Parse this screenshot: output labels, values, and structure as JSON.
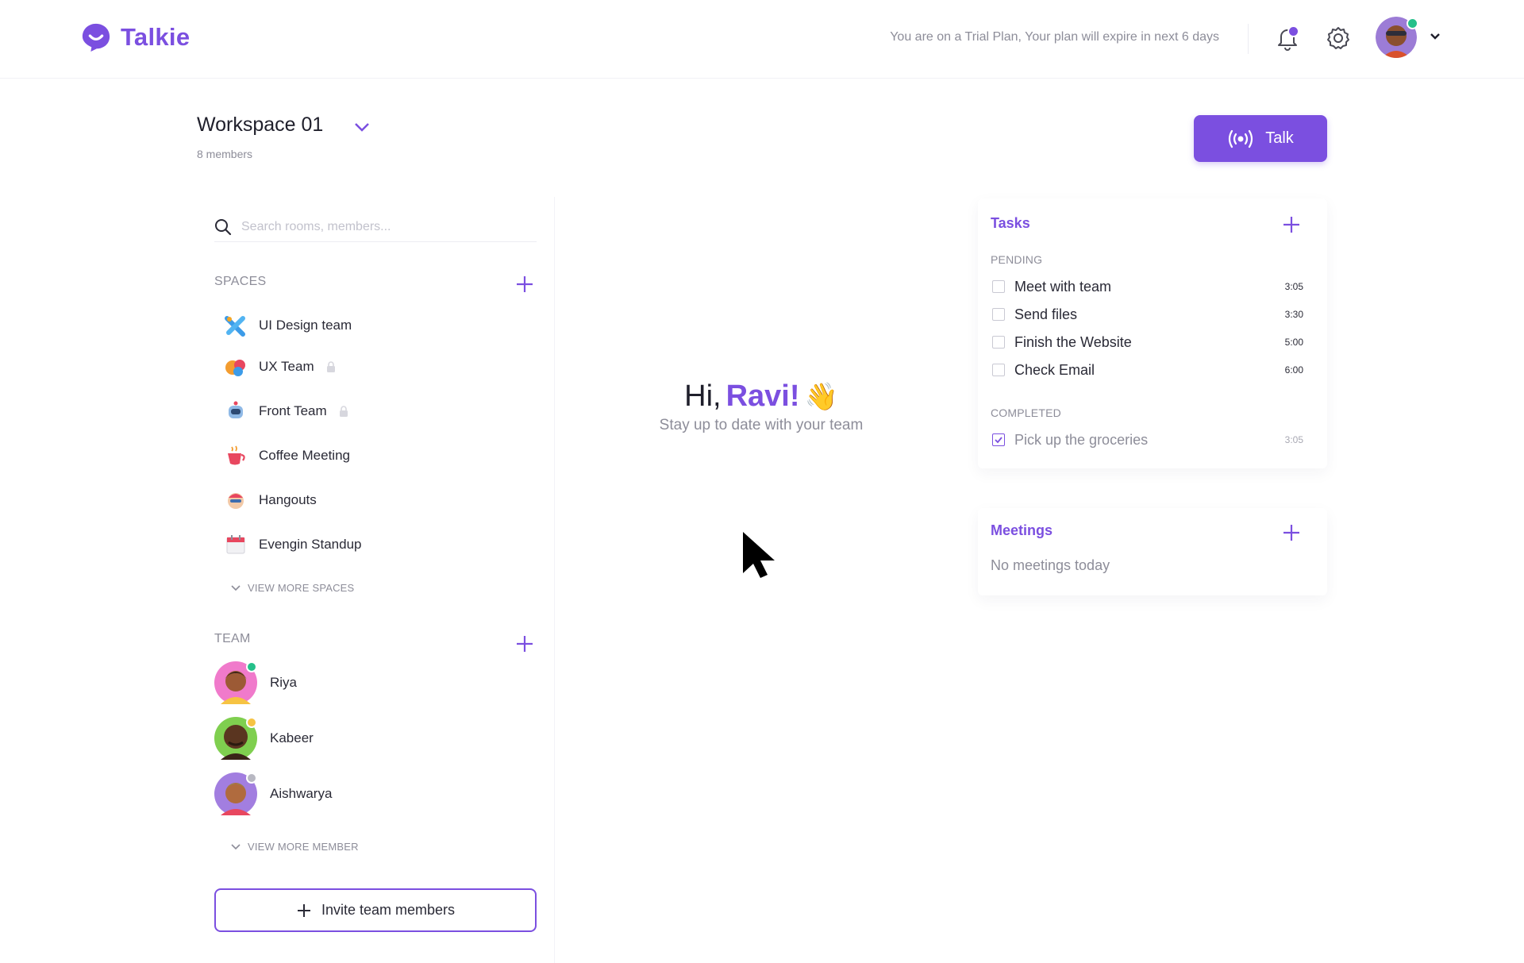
{
  "app": {
    "name": "Talkie",
    "brand_color": "#7b4fe0"
  },
  "header": {
    "trial_text": "You are on a Trial Plan, Your plan will expire in next 6 days",
    "notification_icon": "bell-icon",
    "settings_icon": "gear-icon",
    "profile_icon": "avatar",
    "menu_icon": "chevron-down-icon"
  },
  "workspace": {
    "name": "Workspace 01",
    "members": "8 members"
  },
  "talk_button": {
    "label": "Talk",
    "icon": "broadcast-icon"
  },
  "search": {
    "placeholder": "Search rooms, members..."
  },
  "spaces": {
    "title": "SPACES",
    "items": [
      {
        "label": "UI Design team",
        "icon": "tools-icon",
        "locked": false
      },
      {
        "label": "UX Team",
        "icon": "palette-icon",
        "locked": true
      },
      {
        "label": "Front Team",
        "icon": "robot-icon",
        "locked": true
      },
      {
        "label": "Coffee Meeting",
        "icon": "coffee-icon",
        "locked": false
      },
      {
        "label": "Hangouts",
        "icon": "party-icon",
        "locked": false
      },
      {
        "label": "Evengin Standup",
        "icon": "calendar-icon",
        "locked": false
      }
    ],
    "view_more": "VIEW MORE SPACES"
  },
  "team": {
    "title": "TEAM",
    "members": [
      {
        "name": "Riya",
        "status": "online",
        "status_color": "#25c08a"
      },
      {
        "name": "Kabeer",
        "status": "away",
        "status_color": "#f6c343"
      },
      {
        "name": "Aishwarya",
        "status": "offline",
        "status_color": "#b8b8c2"
      }
    ],
    "view_more": "VIEW MORE MEMBER"
  },
  "invite_button": {
    "label": "Invite team members"
  },
  "greeting": {
    "prefix": "Hi,",
    "name": "Ravi!",
    "emoji": "👋",
    "subtitle": "Stay up to date with your team"
  },
  "tasks": {
    "title": "Tasks",
    "pending_label": "PENDING",
    "pending": [
      {
        "label": "Meet with team",
        "time": "3:05"
      },
      {
        "label": "Send files",
        "time": "3:30"
      },
      {
        "label": "Finish the Website",
        "time": "5:00"
      },
      {
        "label": "Check Email",
        "time": "6:00"
      }
    ],
    "completed_label": "COMPLETED",
    "completed": [
      {
        "label": "Pick up the groceries",
        "time": "3:05"
      }
    ]
  },
  "meetings": {
    "title": "Meetings",
    "empty": "No meetings today"
  }
}
